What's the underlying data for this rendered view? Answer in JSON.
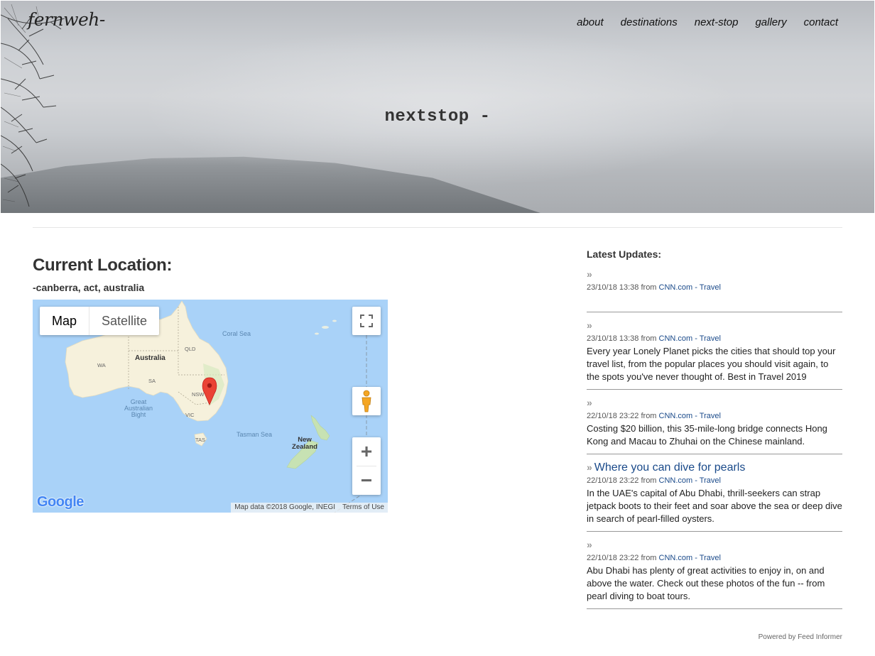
{
  "header": {
    "brand": "fernweh-",
    "nav": [
      "about",
      "destinations",
      "next-stop",
      "gallery",
      "contact"
    ],
    "hero_title": "nextstop -"
  },
  "location": {
    "heading": "Current Location:",
    "place": "-canberra, act, australia"
  },
  "map": {
    "type_buttons": [
      "Map",
      "Satellite"
    ],
    "active_type": "Map",
    "labels": {
      "australia": "Australia",
      "wa": "WA",
      "qld": "QLD",
      "sa": "SA",
      "nsw": "NSW",
      "vic": "VIC",
      "tas": "TAS",
      "coral_sea": "Coral Sea",
      "tasman_sea": "Tasman Sea",
      "great_australian_bight": [
        "Great",
        "Australian",
        "Bight"
      ],
      "new_zealand": [
        "New",
        "Zealand"
      ]
    },
    "zoom_in": "+",
    "zoom_out": "−",
    "attribution": "Map data ©2018 Google, INEGI",
    "terms": "Terms of Use",
    "logo": "Google",
    "colors": {
      "water": "#a9d2f8",
      "land": "#f6f1dc",
      "pin": "#ea4335"
    }
  },
  "updates": {
    "heading": "Latest Updates:",
    "items": [
      {
        "title": "",
        "date": "23/10/18 13:38",
        "from": "from",
        "source": "CNN.com - Travel",
        "desc": ""
      },
      {
        "title": "",
        "date": "23/10/18 13:38",
        "from": "from",
        "source": "CNN.com - Travel",
        "desc": "Every year Lonely Planet picks the cities that should top your travel list, from the popular places you should visit again, to the spots you've never thought of. Best in Travel 2019"
      },
      {
        "title": "",
        "date": "22/10/18 23:22",
        "from": "from",
        "source": "CNN.com - Travel",
        "desc": "Costing $20 billion, this 35-mile-long bridge connects Hong Kong and Macau to Zhuhai on the Chinese mainland."
      },
      {
        "title": "Where you can dive for pearls",
        "date": "22/10/18 23:22",
        "from": "from",
        "source": "CNN.com - Travel",
        "desc": "In the UAE's capital of Abu Dhabi, thrill-seekers can strap jetpack boots to their feet and soar above the sea or deep dive in search of pearl-filled oysters."
      },
      {
        "title": "",
        "date": "22/10/18 23:22",
        "from": "from",
        "source": "CNN.com - Travel",
        "desc": "Abu Dhabi has plenty of great activities to enjoy in, on and above the water. Check out these photos of the fun -- from pearl diving to boat tours."
      }
    ],
    "powered_by": "Powered by Feed Informer"
  }
}
